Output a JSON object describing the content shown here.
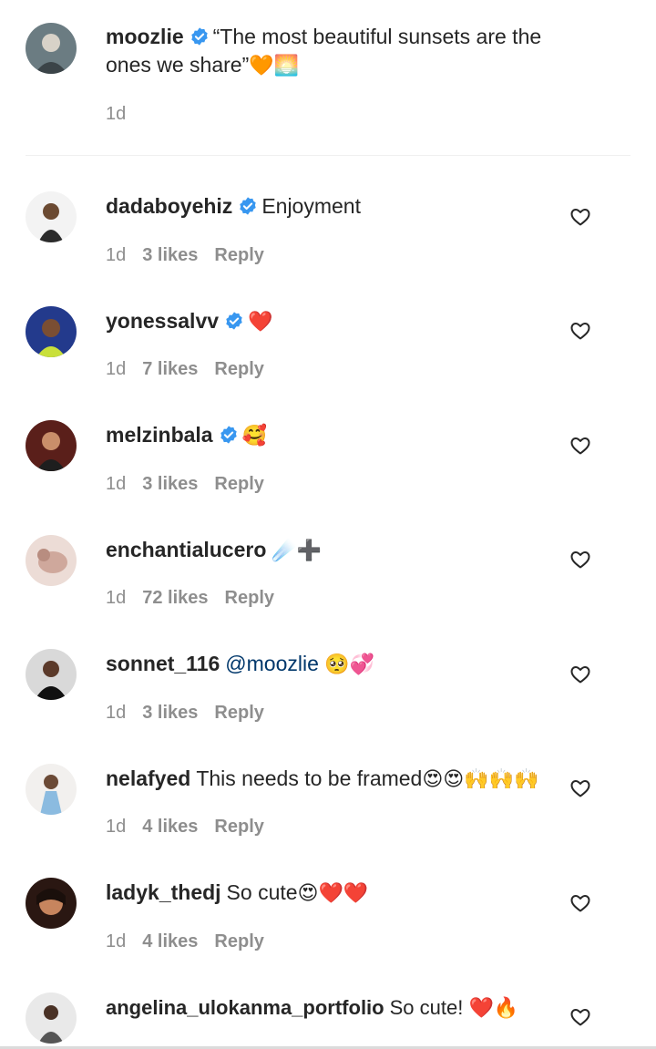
{
  "caption": {
    "username": "moozlie",
    "verified": true,
    "text_line1": "“The most beautiful sunsets are the",
    "text_line2": "ones we share”",
    "emojis": "🧡🌅",
    "time": "1d"
  },
  "colors": {
    "verified_badge": "#3897f0",
    "meta_text": "#8e8e8e",
    "mention": "#00376b"
  },
  "comments": [
    {
      "username": "dadaboyehiz",
      "verified": true,
      "text": "Enjoyment",
      "emojis": "",
      "time": "1d",
      "likes": "3 likes",
      "reply": "Reply"
    },
    {
      "username": "yonessalvv",
      "verified": true,
      "text": "",
      "emojis": "❤️",
      "time": "1d",
      "likes": "7 likes",
      "reply": "Reply"
    },
    {
      "username": "melzinbala",
      "verified": true,
      "text": "",
      "emojis": "🥰",
      "time": "1d",
      "likes": "3 likes",
      "reply": "Reply"
    },
    {
      "username": "enchantialucero",
      "verified": false,
      "text": "",
      "emojis": "☄️➕",
      "time": "1d",
      "likes": "72 likes",
      "reply": "Reply"
    },
    {
      "username": "sonnet_116",
      "verified": false,
      "mention": "@moozlie",
      "text": "",
      "emojis": "🥺💞",
      "time": "1d",
      "likes": "3 likes",
      "reply": "Reply"
    },
    {
      "username": "nelafyed",
      "verified": false,
      "text": "This needs to be framed",
      "emojis": "😍😍🙌🙌🙌",
      "time": "1d",
      "likes": "4 likes",
      "reply": "Reply"
    },
    {
      "username": "ladyk_thedj",
      "verified": false,
      "text": "So cute",
      "emojis": "😍❤️❤️",
      "time": "1d",
      "likes": "4 likes",
      "reply": "Reply"
    },
    {
      "username": "angelina_ulokanma_portfolio",
      "verified": false,
      "text": "So cute!",
      "emojis": "❤️🔥",
      "time": "",
      "likes": "",
      "reply": ""
    }
  ]
}
